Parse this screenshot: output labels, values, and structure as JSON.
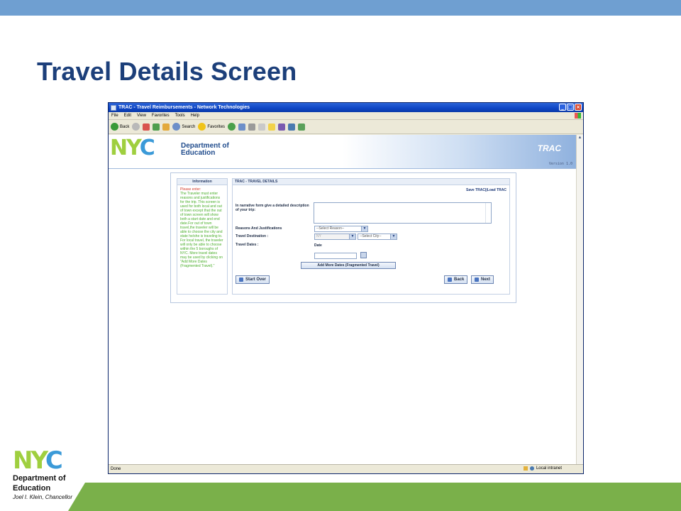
{
  "slide": {
    "title": "Travel Details Screen",
    "logo": {
      "nyc": "NYC",
      "department": "Department of",
      "education": "Education",
      "chancellor": "Joel I. Klein, Chancellor"
    }
  },
  "browser": {
    "window_title": "TRAC - Travel Reimbursements - Network Technologies",
    "menu": [
      "File",
      "Edit",
      "View",
      "Favorites",
      "Tools",
      "Help"
    ],
    "toolbar": {
      "back": "Back",
      "search": "Search",
      "favorites": "Favorites"
    },
    "status_left": "Done",
    "status_zone": "Local intranet"
  },
  "app": {
    "header": {
      "nyc": "NYC",
      "department": "Department of",
      "education": "Education",
      "trac": "TRAC",
      "version": "Version 1.0"
    },
    "info_panel": {
      "heading": "Information",
      "please_enter": "Please enter:",
      "body": "The Traveler must enter reasons and justifications for the trip. This screen is used for both local and out of town except that the out of town screen will show both a start date and end date.For out of town travel,the traveler will be able to choose the city and state he/she is traveling to. For local travel, the traveler will only be able to choose within the 5 boroughs of NYC. More travel dates may be used by clicking on \"Add More Dates (Fragmented Travel).\""
    },
    "main_panel": {
      "heading": "TRAC - TRAVEL DETAILS",
      "links": "Save TRAC||Load TRAC",
      "narrative_label": "In narrative form give a detailed description of your trip:",
      "reasons_label": "Reasons And Justifications",
      "reasons_select": "--Select Reason--",
      "destination_label": "Travel Destination :",
      "state_select": "NY",
      "city_select": "--Select City--",
      "dates_label": "Travel Dates :",
      "date_column": "Date",
      "add_dates_button": "Add More Dates (Fragmented Travel)",
      "start_over_button": "Start Over",
      "back_button": "Back",
      "next_button": "Next"
    }
  }
}
